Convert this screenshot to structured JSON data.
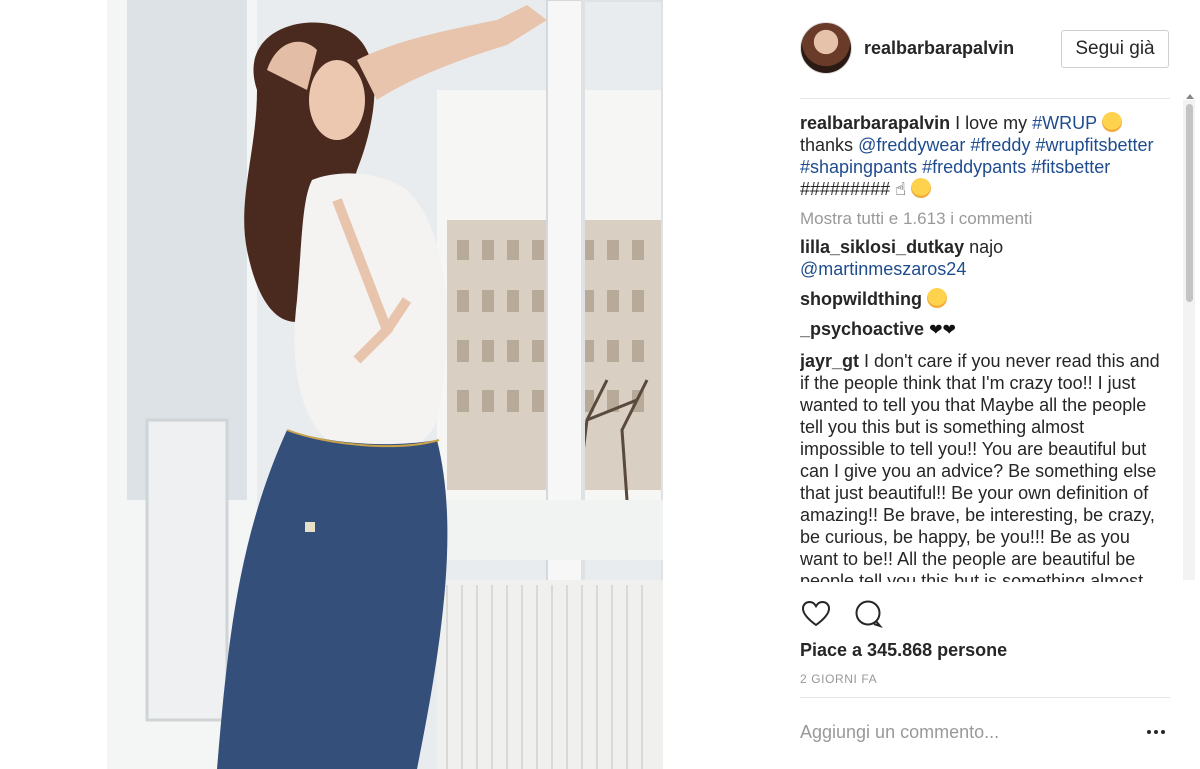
{
  "post": {
    "username": "realbarbarapalvin",
    "follow_label": "Segui già",
    "caption": {
      "user": "realbarbarapalvin",
      "t1": "I love my",
      "h1": "#WRUP",
      "t2": "thanks",
      "m1": "@freddywear",
      "h2": "#freddy",
      "h3": "#wrupfitsbetter",
      "h4": "#shapingpants",
      "h5": "#freddypants",
      "h6": "#fitsbetter",
      "t3": "#########"
    },
    "view_all_comments": "Mostra tutti e 1.613 i commenti",
    "comments": [
      {
        "user": "lilla_siklosi_dutkay",
        "text": "najo",
        "mention": "@martinmeszaros24"
      },
      {
        "user": "shopwildthing",
        "text": ""
      },
      {
        "user": "_psychoactive",
        "text": "❤❤"
      },
      {
        "user": "jayr_gt",
        "text": "I don't care if you never read this and if the people think that I'm crazy too!! I just wanted to tell you that Maybe all the people tell you this but is something almost impossible to tell you!! You are beautiful but can I give you an advice? Be something else that just beautiful!! Be your own definition of amazing!! Be brave, be interesting, be crazy, be curious, be happy, be you!!! Be as you want to be!! All the people are beautiful be people tell you this but is something almost"
      }
    ],
    "likes": "Piace a 345.868 persone",
    "time": "2 GIORNI FA",
    "add_comment_placeholder": "Aggiungi un commento...",
    "icons": {
      "like": "heart-outline-icon",
      "comment": "comment-bubble-icon",
      "more": "more-options-icon"
    },
    "colors": {
      "link": "#1f4c8f",
      "muted": "#999999",
      "text": "#262626"
    }
  }
}
